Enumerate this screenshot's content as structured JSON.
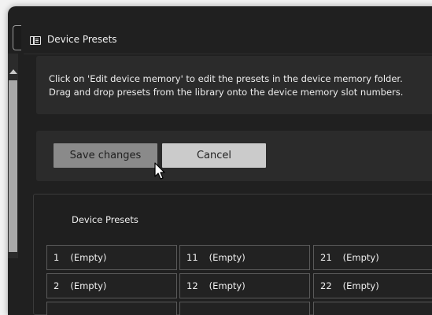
{
  "window": {
    "title": "Device Presets",
    "title_icon": "preset-list-icon"
  },
  "info": {
    "line1": "Click on 'Edit device memory' to edit the presets in the device memory folder.",
    "line2": "Drag and drop presets from the library onto the device memory slot numbers."
  },
  "actions": {
    "save_label": "Save changes",
    "cancel_label": "Cancel"
  },
  "presets": {
    "heading": "Device Presets",
    "rows": [
      [
        {
          "num": "1",
          "label": "(Empty)"
        },
        {
          "num": "11",
          "label": "(Empty)"
        },
        {
          "num": "21",
          "label": "(Empty)"
        }
      ],
      [
        {
          "num": "2",
          "label": "(Empty)"
        },
        {
          "num": "12",
          "label": "(Empty)"
        },
        {
          "num": "22",
          "label": "(Empty)"
        }
      ],
      [
        {
          "num": "",
          "label": ""
        },
        {
          "num": "",
          "label": ""
        },
        {
          "num": "",
          "label": ""
        }
      ]
    ]
  },
  "colors": {
    "background": "#202020",
    "panel": "#2b2b2b",
    "save_button": "#8a8a8a",
    "cancel_button": "#cbcbcb",
    "text": "#f0f0f0"
  }
}
